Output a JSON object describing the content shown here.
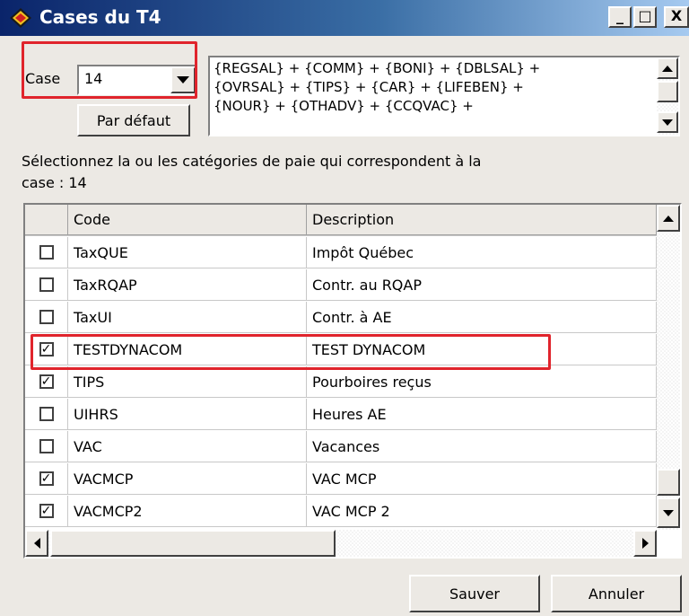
{
  "window": {
    "title": "Cases du T4",
    "controls": {
      "minimize": "_",
      "maximize": "□",
      "close": "X"
    }
  },
  "case": {
    "label": "Case",
    "value": "14",
    "default_button": "Par défaut"
  },
  "formula": {
    "lines": [
      "{REGSAL} + {COMM} + {BONI} + {DBLSAL} +",
      "{OVRSAL} + {TIPS} + {CAR} + {LIFEBEN} +",
      "{NOUR} + {OTHADV} + {CCQVAC} +"
    ]
  },
  "instruction": {
    "line1": "Sélectionnez la ou les catégories de paie qui correspondent à la",
    "line2": "case : 14"
  },
  "grid": {
    "headers": {
      "code": "Code",
      "description": "Description"
    },
    "rows": [
      {
        "code": "TaxQUE",
        "description": "Impôt Québec",
        "checked": false
      },
      {
        "code": "TaxRQAP",
        "description": "Contr. au RQAP",
        "checked": false
      },
      {
        "code": "TaxUI",
        "description": "Contr. à AE",
        "checked": false
      },
      {
        "code": "TESTDYNACOM",
        "description": "TEST DYNACOM",
        "checked": true
      },
      {
        "code": "TIPS",
        "description": "Pourboires reçus",
        "checked": true
      },
      {
        "code": "UIHRS",
        "description": "Heures AE",
        "checked": false
      },
      {
        "code": "VAC",
        "description": "Vacances",
        "checked": false
      },
      {
        "code": "VACMCP",
        "description": "VAC MCP",
        "checked": true
      },
      {
        "code": "VACMCP2",
        "description": "VAC MCP 2",
        "checked": true
      }
    ]
  },
  "buttons": {
    "save": "Sauver",
    "cancel": "Annuler"
  },
  "colors": {
    "highlight": "#e0242c",
    "title_start": "#0a246a",
    "title_end": "#a6caf0"
  }
}
